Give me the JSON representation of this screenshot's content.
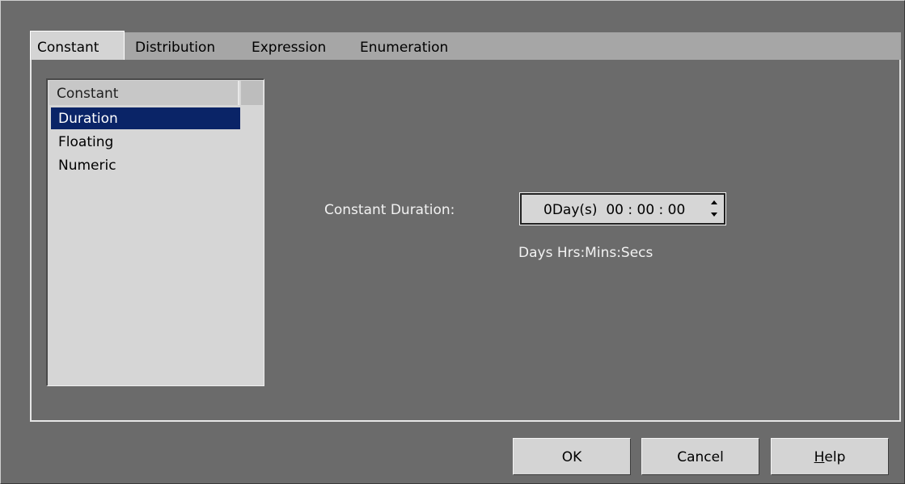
{
  "tabs": [
    {
      "label": "Constant",
      "active": true
    },
    {
      "label": "Distribution",
      "active": false
    },
    {
      "label": "Expression",
      "active": false
    },
    {
      "label": "Enumeration",
      "active": false
    }
  ],
  "list": {
    "header": "Constant",
    "items": [
      "Duration",
      "Floating",
      "Numeric"
    ],
    "selected_index": 0
  },
  "field": {
    "label": "Constant Duration:",
    "days": "0",
    "days_unit": "Day(s)",
    "time": "00 : 00 : 00",
    "hint": "Days Hrs:Mins:Secs"
  },
  "buttons": {
    "ok": "OK",
    "cancel": "Cancel",
    "help_first": "H",
    "help_rest": "elp"
  },
  "colors": {
    "background": "#6b6b6b",
    "selection": "#0a2467",
    "control": "#d4d4d4"
  }
}
